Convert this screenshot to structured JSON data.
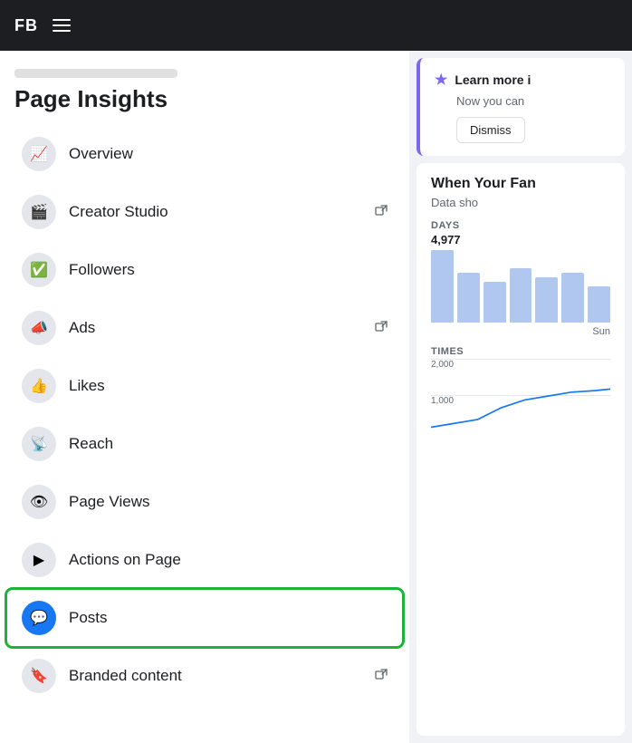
{
  "topbar": {
    "logo": "FB",
    "menu_label": "menu"
  },
  "sidebar": {
    "scroll_indicator": "",
    "title": "Page Insights",
    "nav_items": [
      {
        "id": "overview",
        "label": "Overview",
        "icon": "📈",
        "external": false,
        "active": false
      },
      {
        "id": "creator-studio",
        "label": "Creator Studio",
        "icon": "🎬",
        "external": true,
        "active": false
      },
      {
        "id": "followers",
        "label": "Followers",
        "icon": "✅",
        "external": false,
        "active": false
      },
      {
        "id": "ads",
        "label": "Ads",
        "icon": "📣",
        "external": true,
        "active": false
      },
      {
        "id": "likes",
        "label": "Likes",
        "icon": "👍",
        "external": false,
        "active": false
      },
      {
        "id": "reach",
        "label": "Reach",
        "icon": "📡",
        "external": false,
        "active": false
      },
      {
        "id": "page-views",
        "label": "Page Views",
        "icon": "👁",
        "external": false,
        "active": false
      },
      {
        "id": "actions-on-page",
        "label": "Actions on Page",
        "icon": "▶",
        "external": false,
        "active": false
      },
      {
        "id": "posts",
        "label": "Posts",
        "icon": "💬",
        "external": false,
        "active": true
      },
      {
        "id": "branded-content",
        "label": "Branded content",
        "icon": "🔖",
        "external": true,
        "active": false
      }
    ]
  },
  "right_panel": {
    "learn_card": {
      "title": "Learn more i",
      "text": "Now you can",
      "dismiss_label": "Dismiss"
    },
    "chart_card": {
      "title": "When Your Fan",
      "data_show_label": "Data sho",
      "days_label": "DAYS",
      "days_value": "4,977",
      "day_name": "Sun",
      "times_label": "TIMES",
      "grid_values": [
        "2,000",
        "1,000"
      ],
      "bars": [
        80,
        55,
        45,
        60,
        50,
        55,
        40
      ]
    }
  }
}
